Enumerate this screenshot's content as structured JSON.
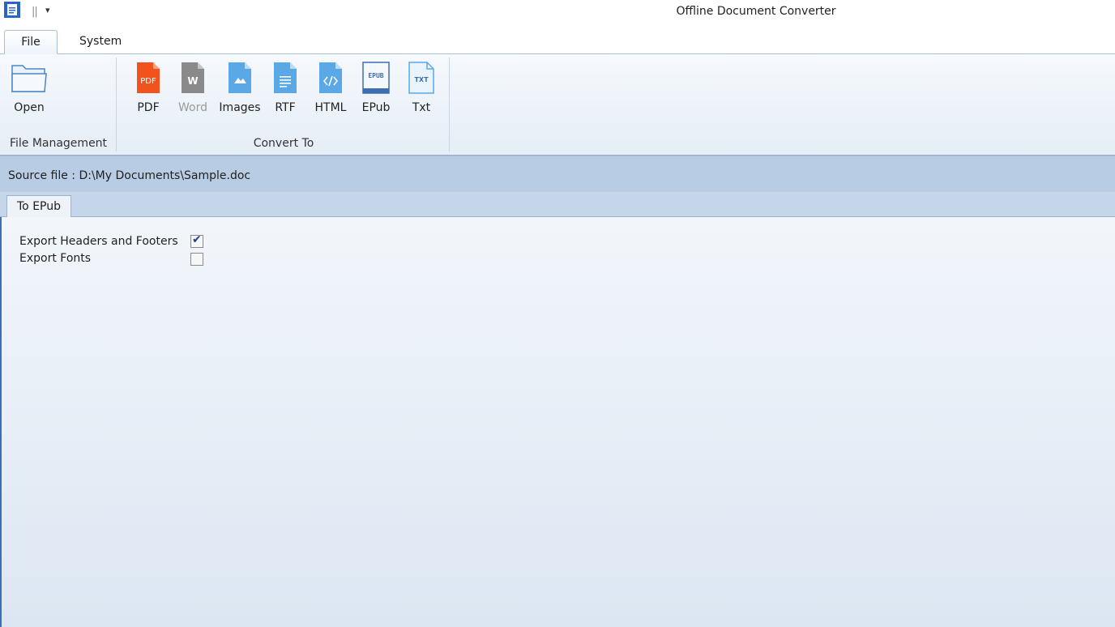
{
  "window": {
    "title": "Offline Document Converter",
    "qat_separator": "||",
    "qat_dropdown": "▾"
  },
  "tabs": [
    {
      "label": "File",
      "active": true
    },
    {
      "label": "System",
      "active": false
    }
  ],
  "ribbon": {
    "groups": [
      {
        "label": "File Management"
      },
      {
        "label": "Convert To"
      }
    ],
    "open_label": "Open",
    "convert_buttons": [
      {
        "label": "PDF",
        "icon": "pdf-icon",
        "color": "#f2521c",
        "disabled": false
      },
      {
        "label": "Word",
        "icon": "word-icon",
        "color": "#8a8a8a",
        "disabled": true
      },
      {
        "label": "Images",
        "icon": "image-icon",
        "color": "#5aa8e6",
        "disabled": false
      },
      {
        "label": "RTF",
        "icon": "rtf-icon",
        "color": "#5aa8e6",
        "disabled": false
      },
      {
        "label": "HTML",
        "icon": "html-icon",
        "color": "#5aa8e6",
        "disabled": false
      },
      {
        "label": "EPub",
        "icon": "epub-icon",
        "color": "#3d6fb0",
        "disabled": false
      },
      {
        "label": "Txt",
        "icon": "txt-icon",
        "color": "#5aa8e6",
        "disabled": false
      }
    ],
    "icon_text": {
      "pdf": "PDF",
      "word": "W",
      "epub": "EPUB",
      "txt": "TXT"
    }
  },
  "source": {
    "text": "Source file : D:\\My Documents\\Sample.doc"
  },
  "options_tab": {
    "label": "To EPub"
  },
  "options": [
    {
      "label": "Export Headers and Footers",
      "checked": true
    },
    {
      "label": "Export Fonts",
      "checked": false
    }
  ]
}
